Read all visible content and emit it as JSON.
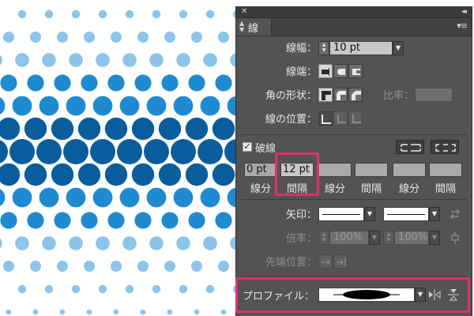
{
  "panel": {
    "close_glyph": "✕",
    "collapse_glyph": "◂◂",
    "tab_label": "線",
    "menu_glyph": "▾≡"
  },
  "stroke": {
    "weight_label": "線幅：",
    "weight_value": "10 pt",
    "cap_label": "線端：",
    "corner_label": "角の形状：",
    "ratio_label": "比率：",
    "align_label": "線の位置："
  },
  "dash": {
    "checkbox_label": "破線",
    "checked_glyph": "✓",
    "fields": [
      {
        "value": "0 pt",
        "label": "線分"
      },
      {
        "value": "12 pt",
        "label": "間隔"
      },
      {
        "value": "",
        "label": "線分"
      },
      {
        "value": "",
        "label": "間隔"
      },
      {
        "value": "",
        "label": "線分"
      },
      {
        "value": "",
        "label": "間隔"
      }
    ]
  },
  "arrows": {
    "label": "矢印：",
    "scale_label": "倍率：",
    "scale_start": "100%",
    "scale_end": "100%",
    "align_label": "先端位置："
  },
  "profile": {
    "label": "プロファイル："
  },
  "colors": {
    "highlight": "#e0306f",
    "panel_bg": "#535353",
    "dot_dark": "#0a5d9c",
    "dot_mid": "#1f8ad0",
    "dot_light": "#8cc4ea"
  }
}
